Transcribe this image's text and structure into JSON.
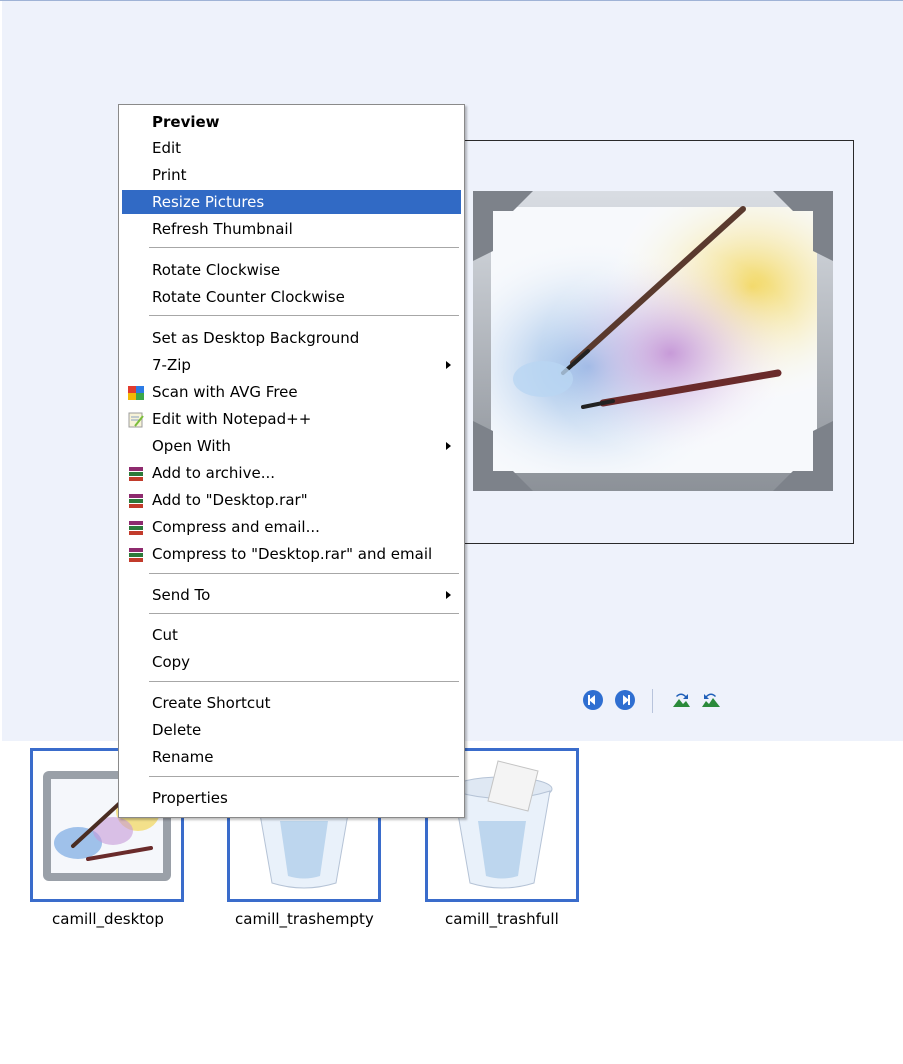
{
  "context_menu": {
    "items": {
      "preview": "Preview",
      "edit": "Edit",
      "print": "Print",
      "resize": "Resize Pictures",
      "refresh": "Refresh Thumbnail",
      "rotate_cw": "Rotate Clockwise",
      "rotate_ccw": "Rotate Counter Clockwise",
      "set_bg": "Set as Desktop Background",
      "seven_zip": "7-Zip",
      "avg": "Scan with AVG Free",
      "notepad": "Edit with Notepad++",
      "open_with": "Open With",
      "add_archive": "Add to archive...",
      "add_rar": "Add to \"Desktop.rar\"",
      "compress_email": "Compress and email...",
      "compress_rar_email": "Compress to \"Desktop.rar\" and email",
      "send_to": "Send To",
      "cut": "Cut",
      "copy": "Copy",
      "create_shortcut": "Create Shortcut",
      "delete": "Delete",
      "rename": "Rename",
      "properties": "Properties"
    },
    "highlighted": "Resize Pictures",
    "highlight_color": "#316ac5"
  },
  "thumbnails": [
    {
      "name": "camill_desktop",
      "icon": "paint-picture-icon"
    },
    {
      "name": "camill_trashempty",
      "icon": "trash-empty-icon"
    },
    {
      "name": "camill_trashfull",
      "icon": "trash-full-icon"
    }
  ],
  "toolbar": {
    "buttons": [
      "previous-image-icon",
      "next-image-icon",
      "rotate-clockwise-icon",
      "rotate-counterclockwise-icon"
    ]
  },
  "colors": {
    "viewer_bg": "#eef2fb",
    "selection": "#3169c6",
    "thumb_border": "#3a6ccb"
  }
}
